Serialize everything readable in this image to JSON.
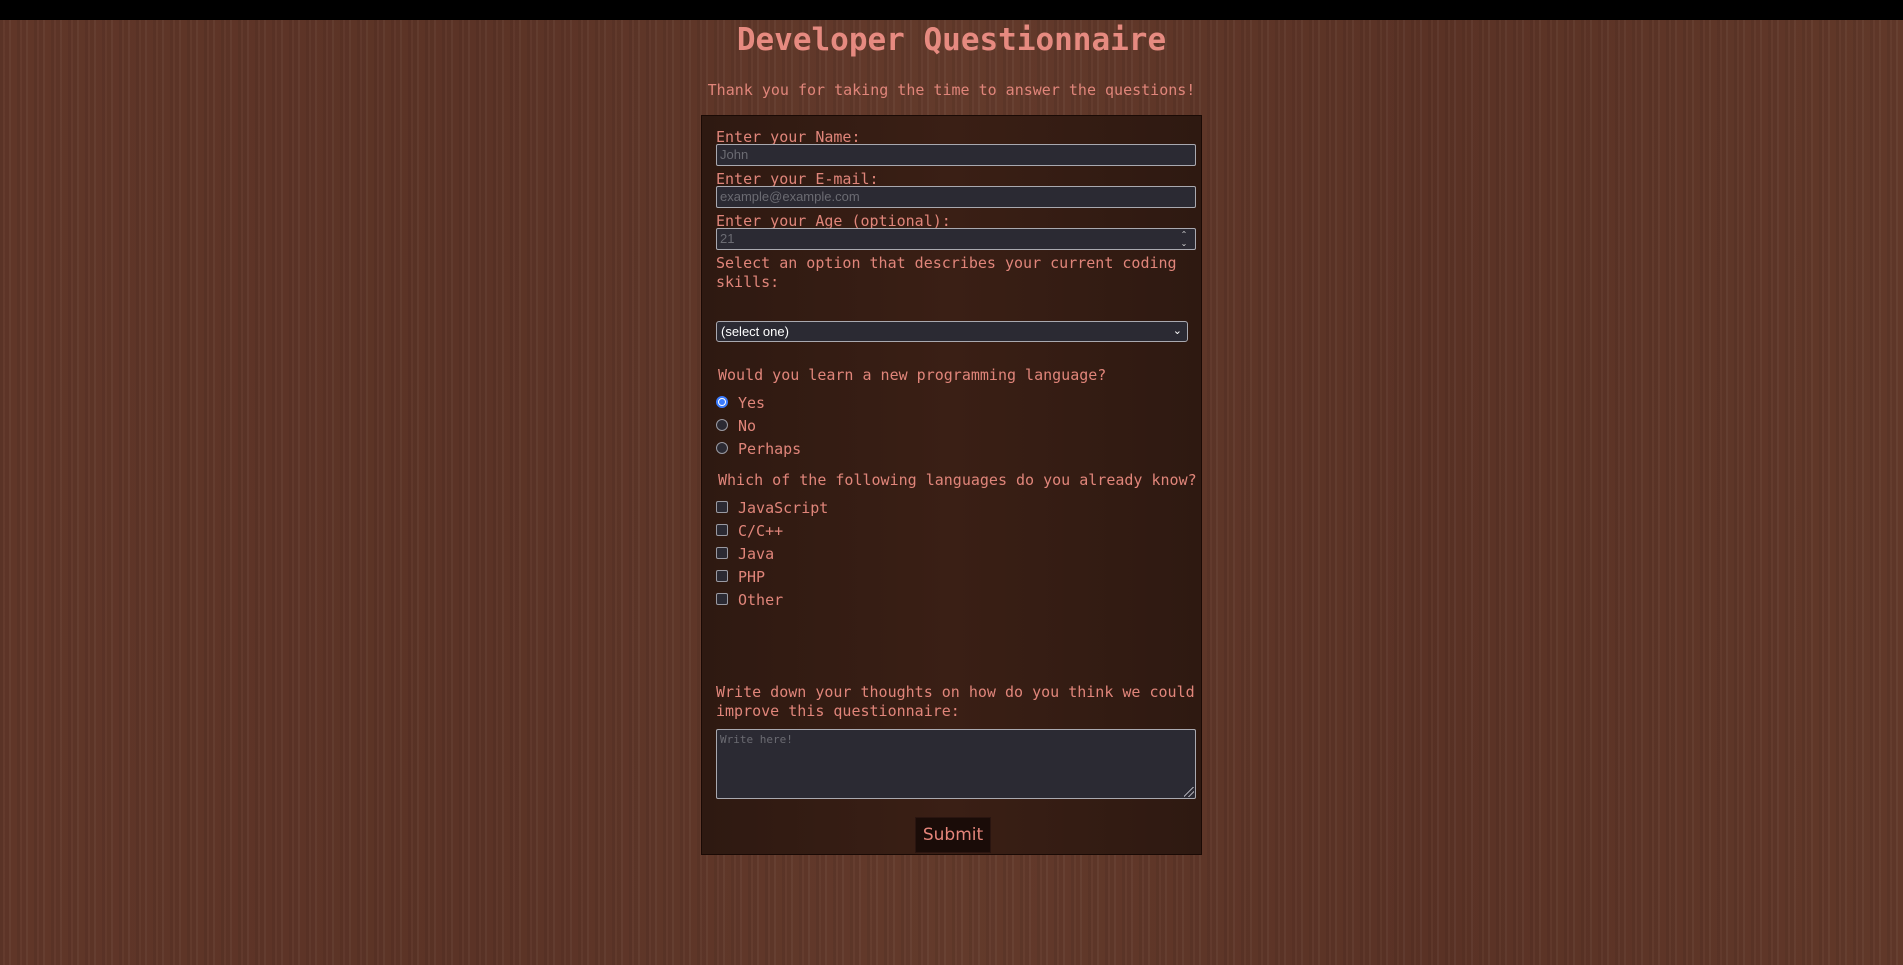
{
  "header": {
    "title": "Developer Questionnaire",
    "subtitle": "Thank you for taking the time to answer the questions!"
  },
  "form": {
    "name": {
      "label": "Enter your Name:",
      "placeholder": "John"
    },
    "email": {
      "label": "Enter your E-mail:",
      "placeholder": "example@example.com"
    },
    "age": {
      "label": "Enter your Age (optional):",
      "placeholder": "21"
    },
    "skills": {
      "label": "Select an option that describes your current coding skills:",
      "selected": "(select one)"
    },
    "learn_new": {
      "question": "Would you learn a new programming language?",
      "options": [
        {
          "label": "Yes",
          "checked": true
        },
        {
          "label": "No",
          "checked": false
        },
        {
          "label": "Perhaps",
          "checked": false
        }
      ]
    },
    "languages": {
      "question": "Which of the following languages do you already know?",
      "options": [
        {
          "label": "JavaScript",
          "checked": false
        },
        {
          "label": "C/C++",
          "checked": false
        },
        {
          "label": "Java",
          "checked": false
        },
        {
          "label": "PHP",
          "checked": false
        },
        {
          "label": "Other",
          "checked": false
        }
      ]
    },
    "thoughts": {
      "label": "Write down your thoughts on how do you think we could improve this questionnaire:",
      "placeholder": "Write here!"
    },
    "submit_label": "Submit"
  },
  "colors": {
    "background": "#5e3527",
    "panel": "#341c13",
    "text": "#e0857a",
    "input_bg": "#2b2a33",
    "radio_accent": "#3b7cff"
  }
}
